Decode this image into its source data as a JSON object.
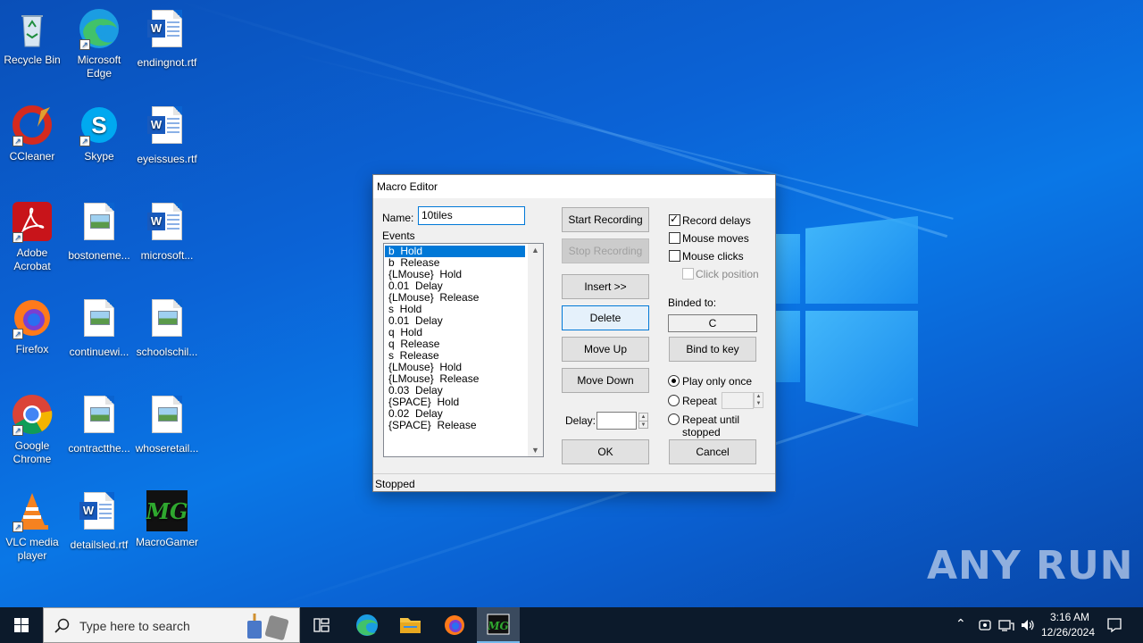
{
  "desktop": {
    "icons": [
      {
        "label": "Recycle Bin"
      },
      {
        "label": "Microsoft Edge"
      },
      {
        "label": "endingnot.rtf"
      },
      {
        "label": "CCleaner"
      },
      {
        "label": "Skype"
      },
      {
        "label": "eyeissues.rtf"
      },
      {
        "label": "Adobe Acrobat"
      },
      {
        "label": "bostoneme..."
      },
      {
        "label": "microsoft..."
      },
      {
        "label": "Firefox"
      },
      {
        "label": "continuewi..."
      },
      {
        "label": "schoolschil..."
      },
      {
        "label": "Google Chrome"
      },
      {
        "label": "contractthe..."
      },
      {
        "label": "whoseretail..."
      },
      {
        "label": "VLC media player"
      },
      {
        "label": "detailsled.rtf"
      },
      {
        "label": "MacroGamer"
      }
    ],
    "watermark": "ANY RUN"
  },
  "dialog": {
    "title": "Macro Editor",
    "name_label": "Name:",
    "name_value": "10tiles",
    "events_label": "Events",
    "events": [
      "b  Hold",
      "b  Release",
      "{LMouse}  Hold",
      "0.01  Delay",
      "{LMouse}  Release",
      "s  Hold",
      "0.01  Delay",
      "q  Hold",
      "q  Release",
      "s  Release",
      "{LMouse}  Hold",
      "{LMouse}  Release",
      "0.03  Delay",
      "{SPACE}  Hold",
      "0.02  Delay",
      "{SPACE}  Release"
    ],
    "selected_event_index": 0,
    "buttons": {
      "start_recording": "Start Recording",
      "stop_recording": "Stop Recording",
      "insert": "Insert >>",
      "delete": "Delete",
      "move_up": "Move Up",
      "move_down": "Move Down",
      "ok": "OK",
      "cancel": "Cancel",
      "bind_to_key": "Bind to key"
    },
    "delay_label": "Delay:",
    "delay_value": "",
    "options": {
      "record_delays": {
        "label": "Record delays",
        "checked": true
      },
      "mouse_moves": {
        "label": "Mouse moves",
        "checked": false
      },
      "mouse_clicks": {
        "label": "Mouse clicks",
        "checked": false
      },
      "click_position": {
        "label": "Click position",
        "checked": false,
        "disabled": true
      }
    },
    "binded_to_label": "Binded to:",
    "binded_key": "C",
    "play_modes": [
      {
        "label": "Play only once",
        "selected": true
      },
      {
        "label": "Repeat",
        "selected": false
      },
      {
        "label": "Repeat until stopped",
        "selected": false
      }
    ],
    "repeat_value": "",
    "status": "Stopped"
  },
  "taskbar": {
    "search_placeholder": "Type here to search",
    "time": "3:16 AM",
    "date": "12/26/2024"
  }
}
